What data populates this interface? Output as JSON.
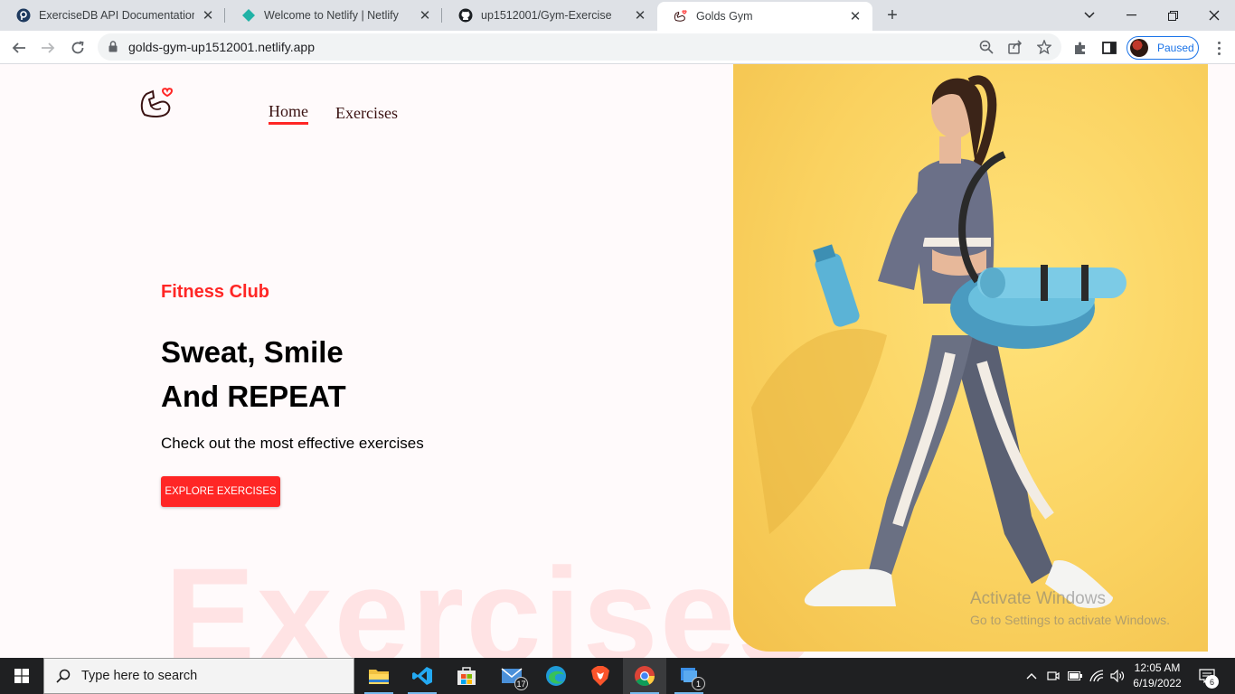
{
  "browser": {
    "tabs": [
      {
        "title": "ExerciseDB API Documentation (",
        "icon": "rapidapi-icon"
      },
      {
        "title": "Welcome to Netlify | Netlify",
        "icon": "netlify-icon"
      },
      {
        "title": "up1512001/Gym-Exercise",
        "icon": "github-icon"
      },
      {
        "title": "Golds Gym",
        "icon": "golds-gym-icon",
        "active": true
      }
    ],
    "address": "golds-gym-up1512001.netlify.app",
    "profile_label": "Paused"
  },
  "page": {
    "nav": {
      "home": "Home",
      "exercises": "Exercises"
    },
    "hero": {
      "subtitle": "Fitness Club",
      "title_line1": "Sweat, Smile",
      "title_line2": "And REPEAT",
      "description": "Check out the most effective exercises",
      "button": "EXPLORE EXERCISES",
      "watermark": "Exercises"
    },
    "colors": {
      "accent": "#ff2625",
      "banner": "#fad260"
    }
  },
  "overlay": {
    "line1": "Activate Windows",
    "line2": "Go to Settings to activate Windows."
  },
  "taskbar": {
    "search_placeholder": "Type here to search",
    "mail_badge": "17",
    "remote_badge": "1",
    "time": "12:05 AM",
    "date": "6/19/2022",
    "notifications": "6"
  }
}
